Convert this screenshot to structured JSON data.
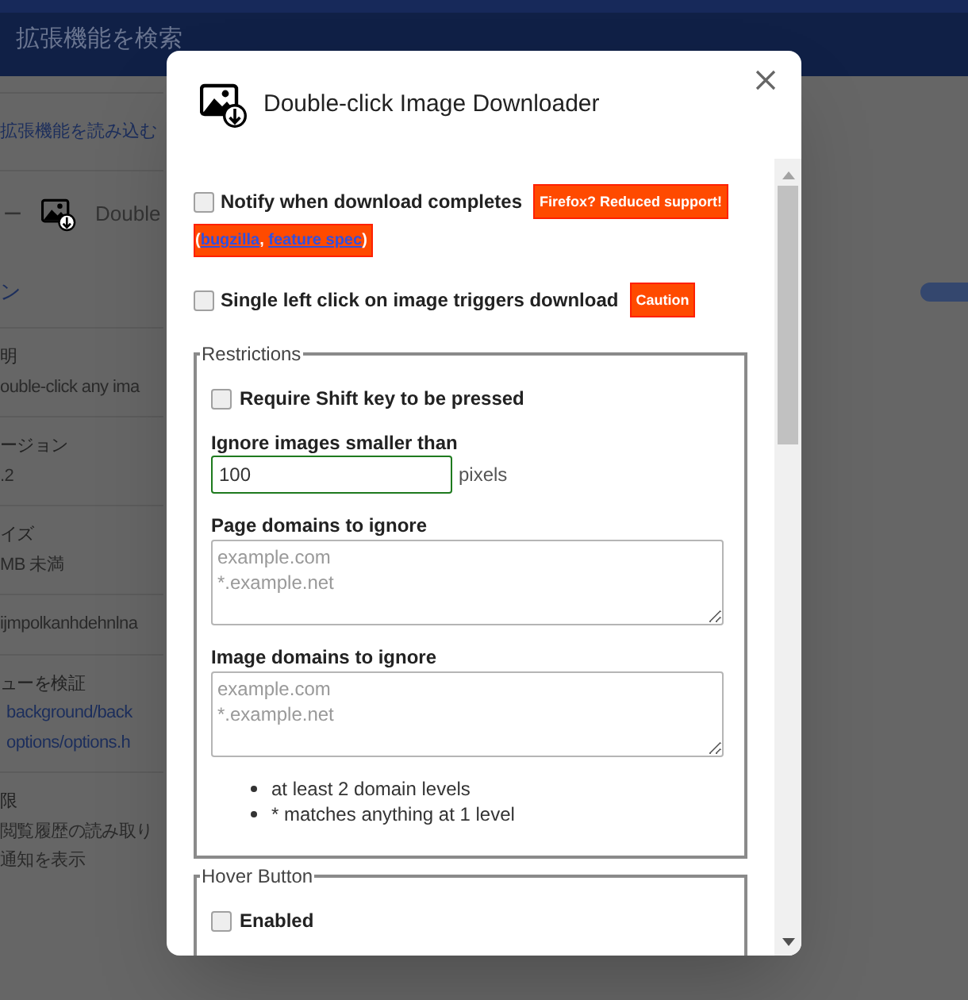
{
  "background_page": {
    "search": {
      "placeholder": "拡張機能を検索"
    },
    "load_link": "拡張機能を読み込む",
    "back_mark": "ー",
    "extension_name": "Double",
    "toggle_label": "ン",
    "toggle": {
      "on": true
    },
    "details": [
      {
        "label": "明",
        "values": [
          "ouble-click any ima"
        ]
      },
      {
        "label": "ージョン",
        "values": [
          ".2"
        ]
      },
      {
        "label": "イズ",
        "values": [
          "MB 未満"
        ]
      },
      {
        "values": [
          "ijmpolkanhdehnlna"
        ]
      },
      {
        "label": "ューを検証",
        "links": [
          "background/back",
          "options/options.h"
        ]
      },
      {
        "label": "限",
        "values": [
          "閲覧履歴の読み取り",
          "通知を表示"
        ]
      }
    ]
  },
  "dialog": {
    "title": "Double-click Image Downloader",
    "options": [
      {
        "kind": "checkbox",
        "label": "Notify when download completes",
        "checked": false,
        "badge": "Firefox? Reduced support!",
        "badge_parts": [
          {
            "kind": "text",
            "text": "("
          },
          {
            "kind": "link",
            "text": "bugzilla"
          },
          {
            "kind": "text",
            "text": ", "
          },
          {
            "kind": "link",
            "text": "feature spec"
          },
          {
            "kind": "text",
            "text": ")"
          }
        ]
      },
      {
        "kind": "checkbox",
        "label": "Single left click on image triggers download",
        "checked": false,
        "badge": "Caution"
      }
    ],
    "fieldsets": [
      {
        "legend": "Restrictions",
        "items": [
          {
            "kind": "checkbox",
            "label": "Require Shift key to be pressed",
            "checked": false
          },
          {
            "kind": "number",
            "label": "Ignore images smaller than",
            "value": "100",
            "unit": "pixels"
          },
          {
            "kind": "textarea",
            "label": "Page domains to ignore",
            "placeholder": "example.com\n*.example.net"
          },
          {
            "kind": "textarea",
            "label": "Image domains to ignore",
            "placeholder": "example.com\n*.example.net"
          },
          {
            "kind": "notes",
            "items": [
              "at least 2 domain levels",
              "* matches anything at 1 level"
            ]
          }
        ]
      },
      {
        "legend": "Hover Button",
        "items": [
          {
            "kind": "checkbox",
            "label": "Enabled",
            "checked": false
          }
        ]
      }
    ]
  }
}
